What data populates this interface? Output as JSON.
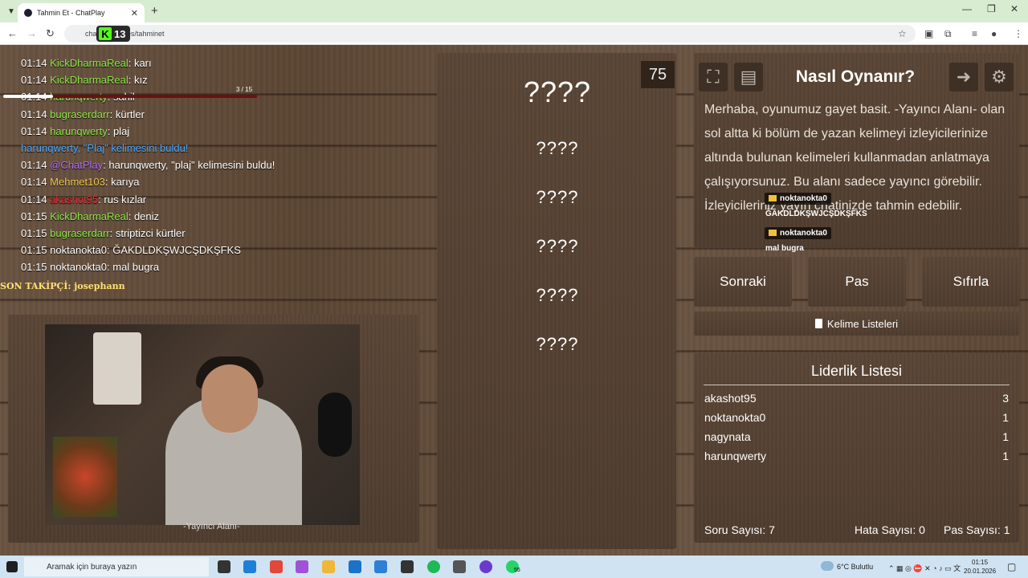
{
  "browser": {
    "tab_title": "Tahmin Et - ChatPlay",
    "url": "cha        r/games/tahminet",
    "kick_badge": "13"
  },
  "overlay": {
    "follow_count": "3 / 15",
    "son_takipci": "SON TAKİPÇİ: josephann"
  },
  "chat": [
    {
      "time": "01:14",
      "user": "KickDharmaReal",
      "color": "#8ee94a",
      "msg": "karı"
    },
    {
      "time": "01:14",
      "user": "KickDharmaReal",
      "color": "#8ee94a",
      "msg": "kız"
    },
    {
      "time": "01:14",
      "user": "harunqwerty",
      "color": "#8ee94a",
      "msg": "sahil"
    },
    {
      "time": "01:14",
      "user": "bugraserdarr",
      "color": "#8ee94a",
      "msg": "kürtler"
    },
    {
      "time": "01:14",
      "user": "harunqwerty",
      "color": "#8ee94a",
      "msg": "plaj"
    },
    {
      "time": "",
      "user": "",
      "color": "#4aa8ff",
      "msg": "harunqwerty, \"Plaj\" kelimesini buldu!"
    },
    {
      "time": "01:14",
      "user": "@ChatPlay",
      "color": "#b46cf0",
      "msg": "harunqwerty, \"plaj\" kelimesini buldu!"
    },
    {
      "time": "01:14",
      "user": "Mehmet103",
      "color": "#f2c94c",
      "msg": "karıya"
    },
    {
      "time": "01:14",
      "user": "akashot95",
      "color": "#e0303a",
      "msg": "rus kızlar"
    },
    {
      "time": "01:15",
      "user": "KickDharmaReal",
      "color": "#8ee94a",
      "msg": "deniz"
    },
    {
      "time": "01:15",
      "user": "bugraserdarr",
      "color": "#8ee94a",
      "msg": "striptizci kürtler"
    },
    {
      "time": "01:15",
      "user": "noktanokta0",
      "color": "#ffffff",
      "msg": "ĞAKDLDKŞWJCŞDKŞFKS"
    },
    {
      "time": "01:15",
      "user": "noktanokta0",
      "color": "#ffffff",
      "msg": "mal bugra"
    }
  ],
  "cam_label": "-Yayıncı Alanı-",
  "words": {
    "main": "????",
    "list": [
      "????",
      "????",
      "????",
      "????",
      "????"
    ],
    "timer": "75"
  },
  "howto": {
    "title": "Nasıl Oynanır?",
    "body": "Merhaba, oyunumuz gayet basit. -Yayıncı Alanı- olan sol altta ki bölüm de yazan kelimeyi izleyicilerinize altında bulunan kelimeleri kullanmadan anlatmaya çalışıyorsunuz. Bu alanı sadece yayıncı görebilir. İzleyicileriniz yayın chatinizde tahmin edebilir."
  },
  "popups": [
    {
      "user": "noktanokta0",
      "msg": "ĞAKDLDKŞWJCŞDKŞFKS"
    },
    {
      "user": "noktanokta0",
      "msg": "mal bugra"
    }
  ],
  "actions": {
    "next": "Sonraki",
    "pass": "Pas",
    "reset": "Sıfırla",
    "word_lists": "Kelime Listeleri"
  },
  "leaderboard": {
    "title": "Liderlik Listesi",
    "rows": [
      {
        "name": "akashot95",
        "score": "3"
      },
      {
        "name": "noktanokta0",
        "score": "1"
      },
      {
        "name": "nagynata",
        "score": "1"
      },
      {
        "name": "harunqwerty",
        "score": "1"
      }
    ]
  },
  "stats": {
    "questions": "Soru Sayısı: 7",
    "errors": "Hata Sayısı: 0",
    "passes": "Pas Sayısı: 1"
  },
  "taskbar": {
    "search_placeholder": "Aramak için buraya yazın",
    "weather": "6°C  Bulutlu",
    "time": "01:15",
    "date": "20.01.2026",
    "whatsapp_badge": "55"
  }
}
